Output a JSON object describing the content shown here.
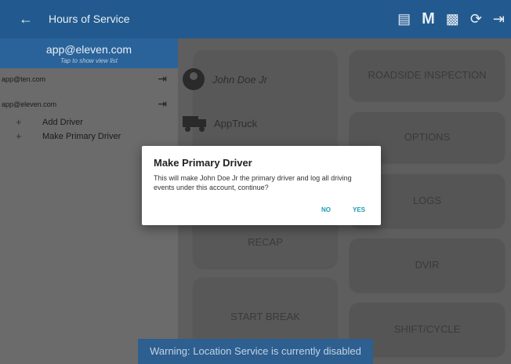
{
  "appbar": {
    "back_icon": "arrow-left-icon",
    "title": "Hours of Service",
    "actions": {
      "messages_icon": "message-icon",
      "m_label": "M",
      "monitor_icon": "monitor-icon",
      "refresh_icon": "refresh-icon",
      "logout_icon": "logout-icon"
    }
  },
  "drawer": {
    "current_email": "app@eleven.com",
    "hint": "Tap to show view list",
    "accounts": [
      {
        "email": "app@ten.com"
      },
      {
        "email": "app@eleven.com"
      }
    ],
    "sub_items": [
      {
        "label": "Add Driver"
      },
      {
        "label": "Make Primary Driver"
      }
    ]
  },
  "main": {
    "driver_name": "John Doe Jr",
    "truck_name": "AppTruck",
    "left_buttons": [
      "RECAP",
      "START BREAK"
    ],
    "right_buttons": [
      "ROADSIDE INSPECTION",
      "OPTIONS",
      "LOGS",
      "DVIR",
      "SHIFT/CYCLE"
    ]
  },
  "dialog": {
    "title": "Make Primary Driver",
    "message": "This will make John Doe Jr the primary driver and log all driving events under this account, continue?",
    "no_label": "NO",
    "yes_label": "YES"
  },
  "snackbar": {
    "text": "Warning: Location Service is currently disabled"
  },
  "colors": {
    "appbar": "#225a8f",
    "accent": "#1e9bb5"
  }
}
